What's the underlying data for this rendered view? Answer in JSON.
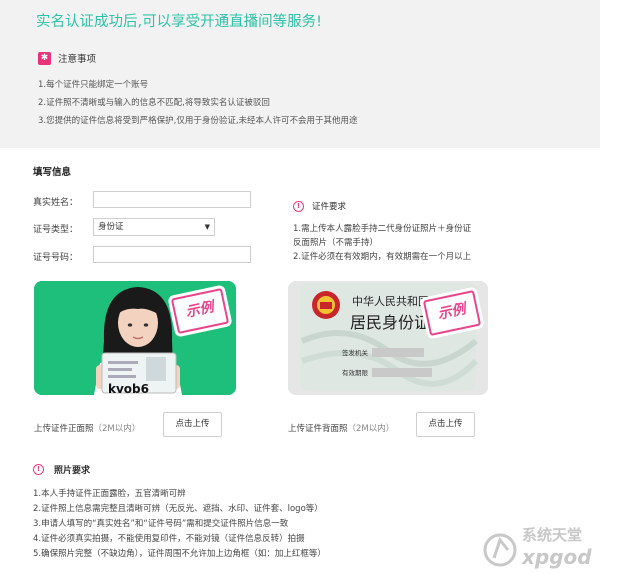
{
  "notice": {
    "headline": "实名认证成功后,可以享受开通直播间等服务!",
    "title": "注意事项",
    "badge": "✱",
    "items": [
      "1.每个证件只能绑定一个账号",
      "2.证件照不清晰或与输入的信息不匹配,将导致实名认证被驳回",
      "3.您提供的证件信息将受到严格保护,仅用于身份验证,未经本人许可不会用于其他用途"
    ]
  },
  "form": {
    "section_title": "填写信息",
    "name_label": "真实姓名：",
    "type_label": "证号类型：",
    "type_value": "身份证",
    "number_label": "证号号码："
  },
  "id_requirements": {
    "title": "证件要求",
    "items": [
      "1.需上传本人露脸手持二代身份证照片＋身份证",
      "反面照片（不需手持）",
      "2.证件必须在有效期内，有效期需在一个月以上"
    ]
  },
  "uploads": {
    "front_label": "上传证件正面照",
    "back_label": "上传证件背面照",
    "size_hint": "（2M以内）",
    "button": "点击上传",
    "sample_stamp": "示例",
    "front_card_text": "kvob6",
    "back_card_line1": "中华人民共和国",
    "back_card_line2": "居民身份证",
    "back_field1": "签发机关",
    "back_field2": "有效期限"
  },
  "photo_requirements": {
    "title": "照片要求",
    "items": [
      "1.本人手持证件正面露脸，五官清晰可辨",
      "2.证件照上信息需完整且清晰可辨（无反光、遮挡、水印、证件套、logo等）",
      "3.申请人填写的“真实姓名”和“证件号码”需和提交证件照片信息一致",
      "4.证件必须真实拍摄，不能使用复印件，不能对镜（证件信息反转）拍摄",
      "5.确保照片完整（不缺边角），证件周围不允许加上边角框（如：加上红框等）"
    ]
  },
  "watermark": {
    "line1": "系统天堂",
    "line2": "xpgod"
  },
  "colors": {
    "accent": "#2ec2a6",
    "pink": "#e8327a",
    "green_photo_bg": "#1dbf7a"
  }
}
